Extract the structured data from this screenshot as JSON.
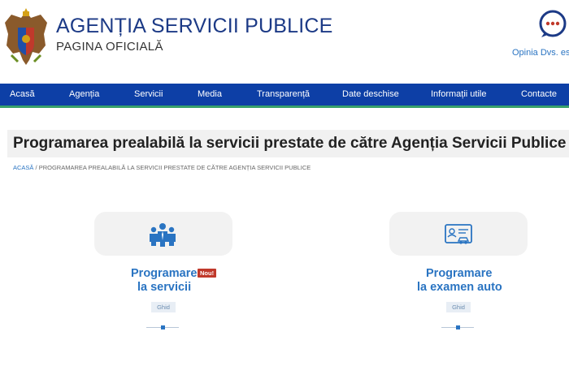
{
  "header": {
    "title": "AGENȚIA SERVICII PUBLICE",
    "subtitle": "PAGINA OFICIALĂ",
    "opinion_text": "Opinia Dvs. est"
  },
  "nav": {
    "items": [
      "Acasă",
      "Agenția",
      "Servicii",
      "Media",
      "Transparență",
      "Date deschise",
      "Informații utile",
      "Contacte"
    ]
  },
  "page": {
    "title": "Programarea prealabilă la servicii prestate de către Agenția Servicii Publice",
    "breadcrumb_home": "ACASĂ",
    "breadcrumb_sep": " / ",
    "breadcrumb_current": "PROGRAMAREA PREALABILĂ LA SERVICII PRESTATE DE CĂTRE AGENȚIA SERVICII PUBLICE"
  },
  "cards": [
    {
      "line1": "Programare",
      "line2": "la servicii",
      "badge": "Nou!",
      "ghid": "Ghid"
    },
    {
      "line1": "Programare",
      "line2": "la examen auto",
      "ghid": "Ghid"
    }
  ],
  "colors": {
    "nav_bg": "#0d3fa6",
    "accent": "#2a74c2",
    "nav_border": "#37a06b",
    "badge": "#c0392b"
  },
  "icons": {
    "coat": "coat-of-arms-icon",
    "opinion": "chat-bubble-icon",
    "card1": "people-group-icon",
    "card2": "id-card-car-icon"
  }
}
